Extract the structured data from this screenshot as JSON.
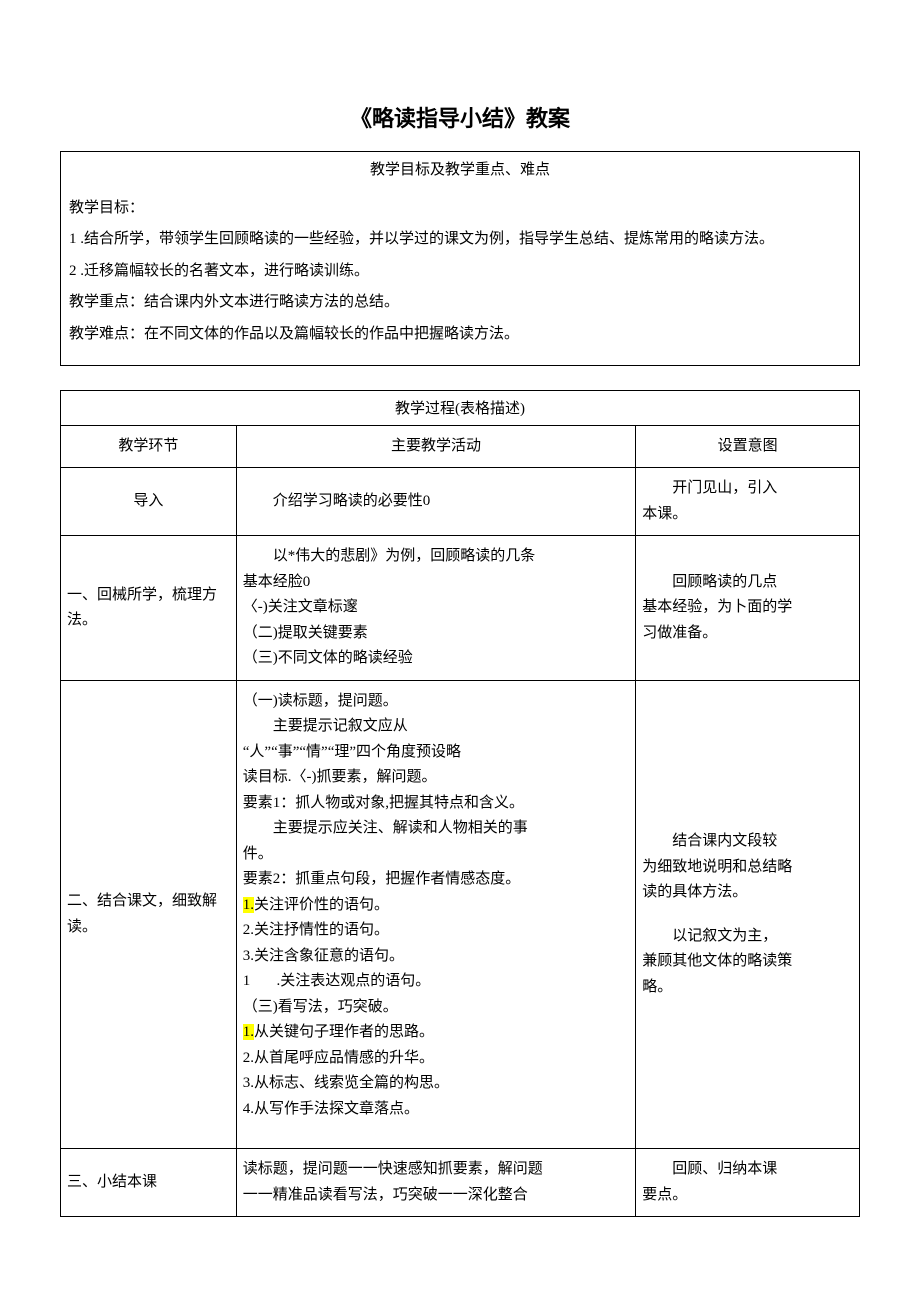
{
  "title": "《略读指导小结》教案",
  "box1": {
    "subtitle": "教学目标及教学重点、难点",
    "p1": "教学目标：",
    "p2": "1 .结合所学，带领学生回顾略读的一些经验，并以学过的课文为例，指导学生总结、提炼常用的略读方法。",
    "p3": "2 .迁移篇幅较长的名著文本，进行略读训练。",
    "p4": "教学重点：结合课内外文本进行略读方法的总结。",
    "p5": "教学难点：在不同文体的作品以及篇幅较长的作品中把握略读方法。"
  },
  "table": {
    "caption": "教学过程(表格描述)",
    "head": {
      "c1": "教学环节",
      "c2": "主要教学活动",
      "c3": "设置意图"
    },
    "rows": [
      {
        "c1": "导入",
        "c2_indent": "介绍学习略读的必要性0",
        "c3_indent": "开门见山，引入",
        "c3_line2": "本课。"
      },
      {
        "c1_l1": "一、回械所学，梳理方",
        "c1_l2": "法。",
        "c2_indent": "以*伟大的悲剧》为例，回顾略读的几条",
        "c2_l2": "基本经脸0",
        "c2_l3": "〈-)关注文章标邃",
        "c2_l4": "（二)提取关键要素",
        "c2_l5": "（三)不同文体的略读经验",
        "c3_indent": "回顾略读的几点",
        "c3_l2": "基本经验，为卜面的学",
        "c3_l3": "习做准备。"
      },
      {
        "c1_l1": "二、结合课文，细致解",
        "c1_l2": "读。",
        "c2_l1": "（一)读标题，提问题。",
        "c2_l2_indent": "主要提示记叙文应从",
        "c2_l3": "“人”“事”“情”“理”四个角度预设略",
        "c2_l4": "读目标.〈-)抓要素，解问题。",
        "c2_l5": "要素1：抓人物或对象,把握其特点和含义。",
        "c2_l6_indent": "主要提示应关注、解读和人物相关的事",
        "c2_l7": "件。",
        "c2_l8": "要素2：抓重点句段，把握作者情感态度。",
        "c2_l9_hl": "1.",
        "c2_l9_rest": "关注评价性的语句。",
        "c2_l10": "2.关注抒情性的语句。",
        "c2_l11": "3.关注含象征意的语句。",
        "c2_l12a": "1",
        "c2_l12b": "       .关注表达观点的语句。",
        "c2_l13": "（三)看写法，巧突破。",
        "c2_l14_hl": "1.",
        "c2_l14_rest": "从关键句子理作者的思路。",
        "c2_l15": "2.从首尾呼应品情感的升华。",
        "c2_l16": "3.从标志、线索览全篇的构思。",
        "c2_l17": "4.从写作手法探文章落点。",
        "c3_p1_indent": "结合课内文段较",
        "c3_p1_l2": "为细致地说明和总结略",
        "c3_p1_l3": "读的具体方法。",
        "c3_p2_indent": "以记叙文为主，",
        "c3_p2_l2": "兼顾其他文体的略读策",
        "c3_p2_l3": "略。"
      },
      {
        "c1": "三、小结本课",
        "c2_l1": "读标题，提问题一一快速感知抓要素，解问题",
        "c2_l2": "一一精准品读看写法，巧突破一一深化整合",
        "c3_indent": "回顾、归纳本课",
        "c3_l2": "要点。"
      }
    ]
  }
}
